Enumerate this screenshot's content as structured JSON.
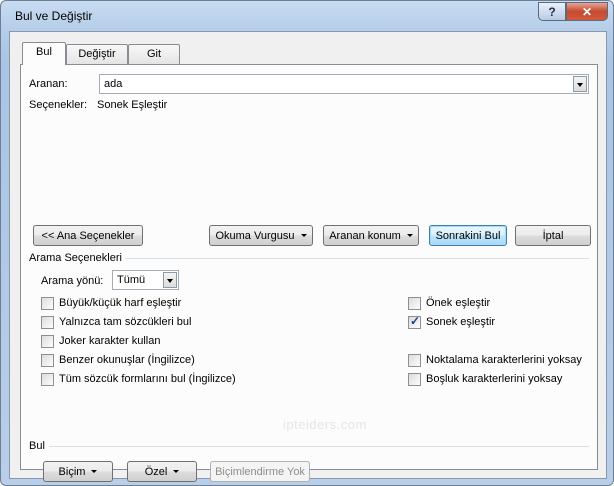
{
  "window": {
    "title": "Bul ve Değiştir",
    "help_glyph": "?",
    "close_glyph": "✕"
  },
  "tabs": [
    {
      "label": "Bul",
      "active": true
    },
    {
      "label": "Değiştir",
      "active": false
    },
    {
      "label": "Git",
      "active": false
    }
  ],
  "find": {
    "label": "Aranan:",
    "value": "ada"
  },
  "options_line": {
    "label": "Seçenekler:",
    "value": "Sonek Eşleştir"
  },
  "buttons": {
    "less_options": "<< Ana Seçenekler",
    "reading_highlight": "Okuma Vurgusu",
    "find_in": "Aranan konum",
    "find_next": "Sonrakini Bul",
    "cancel": "İptal"
  },
  "search_options": {
    "heading": "Arama Seçenekleri",
    "direction_label": "Arama yönü:",
    "direction_value": "Tümü",
    "left_checks": [
      {
        "label": "Büyük/küçük harf eşleştir",
        "checked": false
      },
      {
        "label": "Yalnızca tam sözcükleri bul",
        "checked": false
      },
      {
        "label": "Joker karakter kullan",
        "checked": false
      },
      {
        "label": "Benzer okunuşlar (İngilizce)",
        "checked": false
      },
      {
        "label": "Tüm sözcük formlarını bul (İngilizce)",
        "checked": false
      }
    ],
    "right_checks": [
      {
        "label": "Önek eşleştir",
        "checked": false
      },
      {
        "label": "Sonek eşleştir",
        "checked": true
      },
      {
        "label": "Noktalama karakterlerini yoksay",
        "checked": false
      },
      {
        "label": "Boşluk karakterlerini yoksay",
        "checked": false
      }
    ]
  },
  "find_section": {
    "heading": "Bul",
    "format_button": "Biçim",
    "special_button": "Özel",
    "no_formatting_button": "Biçimlendirme Yok"
  },
  "watermark": "ipteiders.com",
  "colors": {
    "title_bar": "#b5cde8",
    "close_button": "#c44a31",
    "focus_border": "#3c7fb1",
    "check_color": "#1c3f94"
  }
}
